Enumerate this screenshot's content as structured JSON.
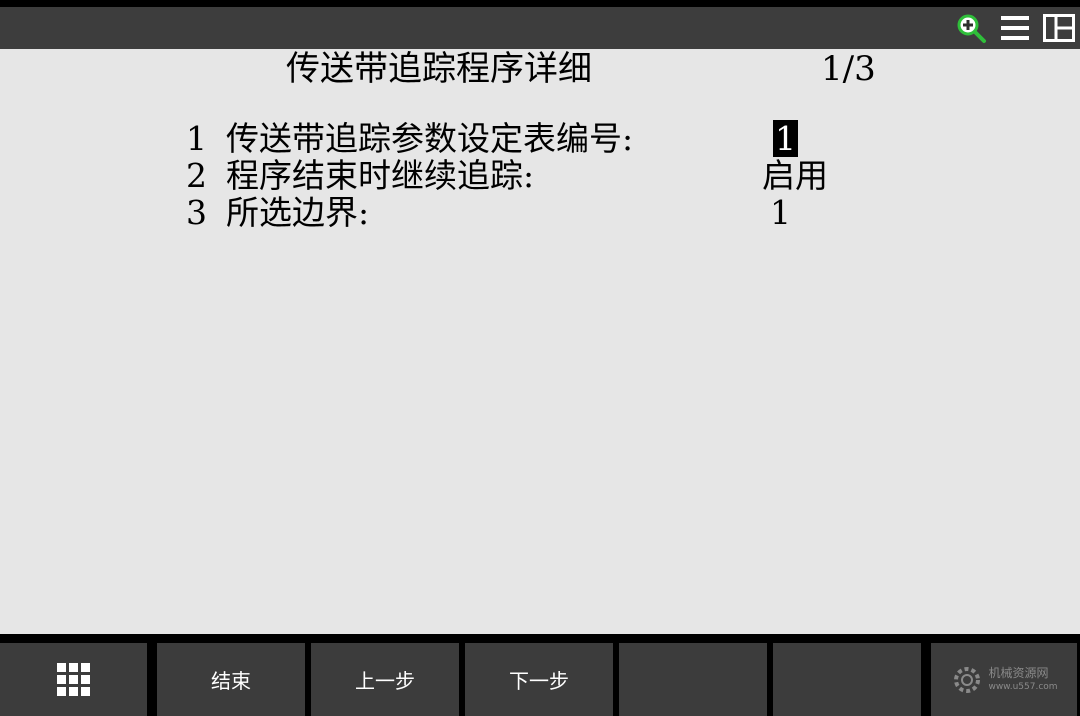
{
  "header": {
    "title": "传送带追踪程序详细",
    "page": "1/3"
  },
  "topbar": {
    "icons": [
      "zoom-in-icon",
      "menu-icon",
      "split-view-icon"
    ],
    "accent_color": "#2fbf3a"
  },
  "items": [
    {
      "num": "1",
      "label": "传送带追踪参数设定表编号:",
      "value": "1",
      "selected": true
    },
    {
      "num": "2",
      "label": "程序结束时继续追踪:",
      "value": "启用",
      "selected": false
    },
    {
      "num": "3",
      "label": "所选边界:",
      "value": "1",
      "selected": false
    }
  ],
  "softkeys": {
    "menu_icon": "grid-menu-icon",
    "f1": "结束",
    "f2": "上一步",
    "f3": "下一步",
    "f4": "",
    "f5": "",
    "watermark": {
      "line1": "机械资源网",
      "line2": "www.u557.com"
    }
  }
}
